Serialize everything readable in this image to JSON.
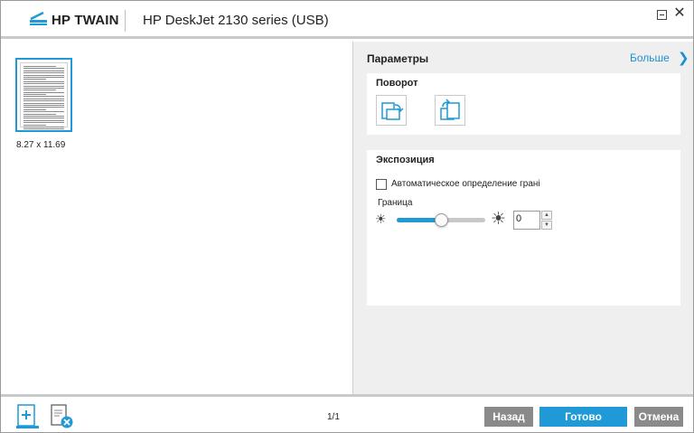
{
  "titlebar": {
    "brand": "HP TWAIN",
    "device": "HP DeskJet 2130 series (USB)",
    "minimize_icon": "minimize-icon",
    "close_icon": "close-icon",
    "close_glyph": "✕"
  },
  "preview": {
    "thumbnail_caption": "8.27  x  11.69"
  },
  "settings": {
    "title": "Параметры",
    "more_label": "Больше",
    "more_chevron": "❯",
    "rotation": {
      "title": "Поворот",
      "rotate_left_icon": "rotate-left-icon",
      "rotate_right_icon": "rotate-right-icon"
    },
    "exposure": {
      "title": "Экспозиция",
      "auto_border_label": "Автоматическое определение грані",
      "auto_border_checked": false,
      "border_label": "Граница",
      "slider_level": 0.5,
      "value": "0",
      "sun_small": "☀",
      "sun_big": "☀",
      "spin_up": "▲",
      "spin_down": "▼"
    }
  },
  "bottombar": {
    "page_indicator": "1/1",
    "back_label": "Назад",
    "done_label": "Готово",
    "cancel_label": "Отмена"
  },
  "colors": {
    "accent": "#1f9ad6",
    "secondary_button": "#8a8a8a",
    "panel_bg": "#efefef"
  }
}
